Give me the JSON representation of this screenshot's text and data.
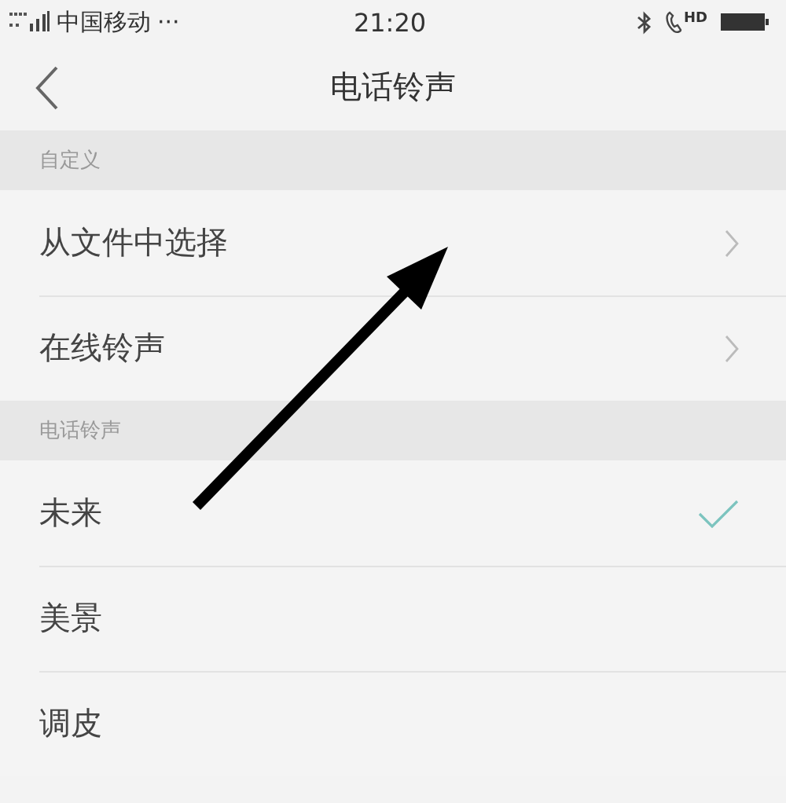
{
  "status_bar": {
    "carrier": "中国移动",
    "more": "···",
    "time": "21:20",
    "hd": "HD"
  },
  "nav": {
    "title": "电话铃声"
  },
  "sections": [
    {
      "header": "自定义",
      "items": [
        {
          "label": "从文件中选择",
          "kind": "link"
        },
        {
          "label": "在线铃声",
          "kind": "link"
        }
      ]
    },
    {
      "header": "电话铃声",
      "items": [
        {
          "label": "未来",
          "kind": "ringtone",
          "selected": true
        },
        {
          "label": "美景",
          "kind": "ringtone",
          "selected": false
        },
        {
          "label": "调皮",
          "kind": "ringtone",
          "selected": false
        }
      ]
    }
  ]
}
